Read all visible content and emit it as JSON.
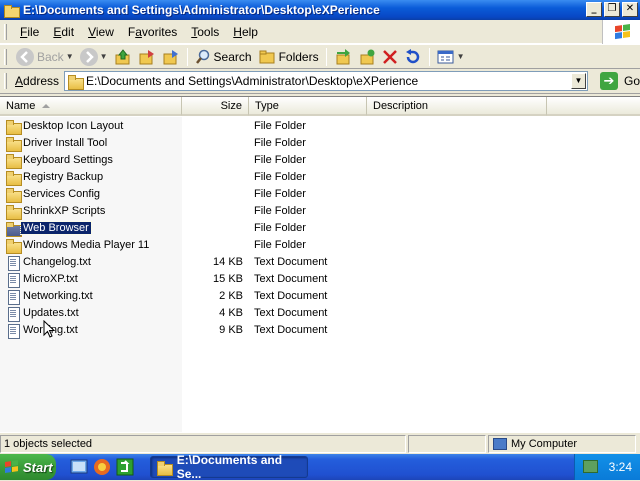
{
  "window": {
    "title": "E:\\Documents and Settings\\Administrator\\Desktop\\eXPerience",
    "buttons": {
      "minimize": "_",
      "maximize": "❐",
      "close": "✕"
    }
  },
  "menu": {
    "items": [
      {
        "accel": "F",
        "rest": "ile"
      },
      {
        "accel": "E",
        "rest": "dit"
      },
      {
        "accel": "V",
        "rest": "iew"
      },
      {
        "accel": "",
        "pre": "F",
        "accel2": "a",
        "rest": "vorites"
      },
      {
        "accel": "T",
        "rest": "ools"
      },
      {
        "accel": "H",
        "rest": "elp"
      }
    ]
  },
  "toolbar": {
    "back_label": "Back",
    "search_label": "Search",
    "folders_label": "Folders"
  },
  "address": {
    "label_accel": "A",
    "label_rest": "ddress",
    "path": "E:\\Documents and Settings\\Administrator\\Desktop\\eXPerience",
    "go_label": "Go"
  },
  "list": {
    "columns": {
      "name": "Name",
      "size": "Size",
      "type": "Type",
      "description": "Description"
    },
    "rows": [
      {
        "name": "Desktop Icon Layout",
        "size": "",
        "type": "File Folder",
        "kind": "folder"
      },
      {
        "name": "Driver Install Tool",
        "size": "",
        "type": "File Folder",
        "kind": "folder"
      },
      {
        "name": "Keyboard Settings",
        "size": "",
        "type": "File Folder",
        "kind": "folder"
      },
      {
        "name": "Registry Backup",
        "size": "",
        "type": "File Folder",
        "kind": "folder"
      },
      {
        "name": "Services Config",
        "size": "",
        "type": "File Folder",
        "kind": "folder"
      },
      {
        "name": "ShrinkXP Scripts",
        "size": "",
        "type": "File Folder",
        "kind": "folder"
      },
      {
        "name": "Web Browser",
        "size": "",
        "type": "File Folder",
        "kind": "folder",
        "selected": true
      },
      {
        "name": "Windows Media Player 11",
        "size": "",
        "type": "File Folder",
        "kind": "folder"
      },
      {
        "name": "Changelog.txt",
        "size": "14 KB",
        "type": "Text Document",
        "kind": "doc"
      },
      {
        "name": "MicroXP.txt",
        "size": "15 KB",
        "type": "Text Document",
        "kind": "doc"
      },
      {
        "name": "Networking.txt",
        "size": "2 KB",
        "type": "Text Document",
        "kind": "doc"
      },
      {
        "name": "Updates.txt",
        "size": "4 KB",
        "type": "Text Document",
        "kind": "doc"
      },
      {
        "name": "Working.txt",
        "size": "9 KB",
        "type": "Text Document",
        "kind": "doc"
      }
    ]
  },
  "status": {
    "selection": "1 objects selected",
    "zone": "My Computer"
  },
  "taskbar": {
    "start_label": "Start",
    "task_label": "E:\\Documents and Se...",
    "clock": "3:24"
  },
  "colors": {
    "title_blue": "#0A5BD8",
    "selection": "#0A246A",
    "start_green": "#3A9D3A",
    "taskbar_blue": "#245EDC"
  }
}
